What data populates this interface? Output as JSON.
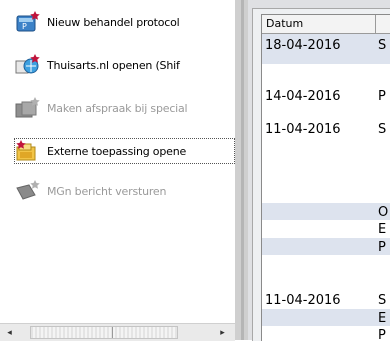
{
  "actions": [
    {
      "label": "Nieuw behandel protocol",
      "enabled": true,
      "icon": "protocol-star-icon"
    },
    {
      "label": "Thuisarts.nl openen  (Shif",
      "enabled": true,
      "icon": "thuisarts-star-icon"
    },
    {
      "label": "Maken afspraak bij special",
      "enabled": false,
      "icon": "appointment-star-icon"
    },
    {
      "label": "Externe toepassing opene",
      "enabled": true,
      "icon": "external-app-star-icon"
    },
    {
      "label": "MGn bericht versturen",
      "enabled": false,
      "icon": "message-star-icon"
    }
  ],
  "scrollbar": {
    "left_arrow": "◂",
    "right_arrow": "▸"
  },
  "grid": {
    "header": {
      "datum": "Datum"
    },
    "rows": [
      {
        "date": "18-04-2016",
        "col2": "S"
      },
      {
        "date": "14-04-2016",
        "col2": "P"
      },
      {
        "date": "11-04-2016",
        "col2": "S"
      },
      {
        "date": "",
        "col2": "O"
      },
      {
        "date": "",
        "col2": "E"
      },
      {
        "date": "",
        "col2": "P"
      },
      {
        "date": "11-04-2016",
        "col2": "S"
      },
      {
        "date": "",
        "col2": "E"
      },
      {
        "date": "",
        "col2": "P"
      }
    ]
  },
  "colors": {
    "accent": "#c0143c",
    "row_highlight": "#dde3ee",
    "disabled_text": "#9a9a9a"
  }
}
